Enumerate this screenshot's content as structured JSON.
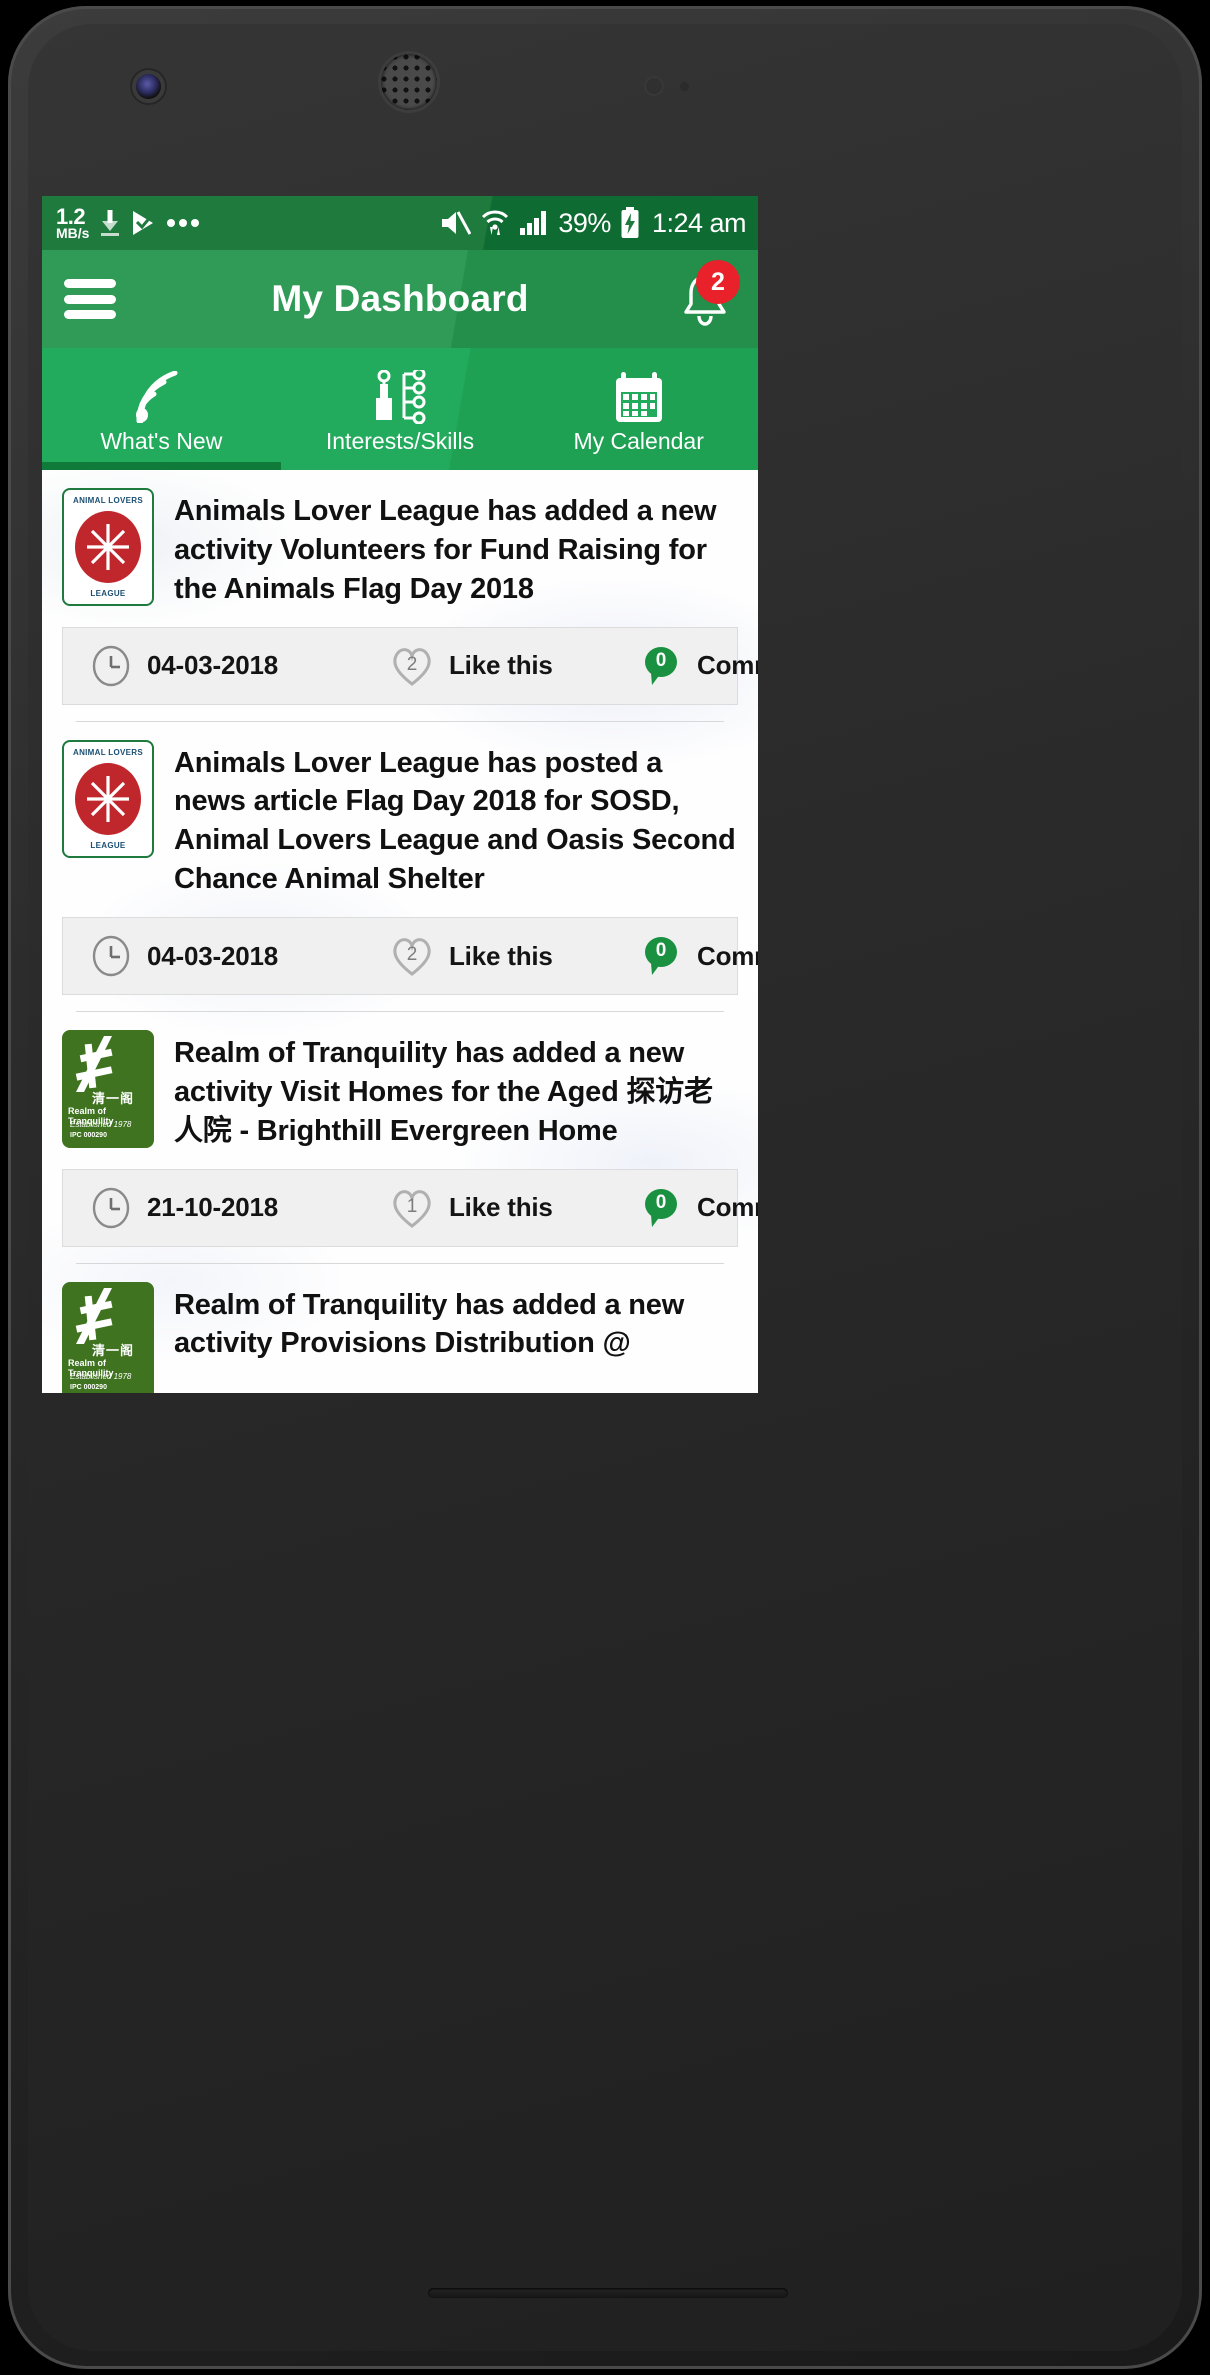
{
  "status_bar": {
    "network_speed_value": "1.2",
    "network_speed_unit": "MB/s",
    "download_icon": "download-arrow-icon",
    "app_icon": "checkmark-play-icon",
    "overflow_icon": "more-dots-icon",
    "mute_icon": "volume-mute-icon",
    "wifi_icon": "wifi-transfer-icon",
    "signal_icon": "cellular-signal-icon",
    "battery_percent": "39%",
    "battery_icon": "battery-charging-icon",
    "time": "1:24 am"
  },
  "app_bar": {
    "menu_icon": "hamburger-menu-icon",
    "title": "My Dashboard",
    "bell_icon": "notification-bell-icon",
    "notification_count": "2"
  },
  "tabs": [
    {
      "label": "What's New",
      "icon": "rss-feed-icon",
      "active": true
    },
    {
      "label": "Interests/Skills",
      "icon": "sliders-icon",
      "active": false
    },
    {
      "label": "My Calendar",
      "icon": "calendar-icon",
      "active": false
    }
  ],
  "feed": [
    {
      "logo_type": "animal-lovers-league",
      "logo_text_top": "ANIMAL LOVERS",
      "logo_text_bottom": "LEAGUE",
      "text": "Animals Lover League has added a new activity Volunteers for Fund Raising for the Animals Flag Day 2018",
      "date": "04-03-2018",
      "like_count": "2",
      "like_label": "Like this",
      "comment_count": "0",
      "comment_label": "Comments"
    },
    {
      "logo_type": "animal-lovers-league",
      "logo_text_top": "ANIMAL LOVERS",
      "logo_text_bottom": "LEAGUE",
      "text": "Animals Lover League has posted a news article Flag Day 2018 for SOSD, Animal Lovers League and Oasis Second Chance Animal Shelter",
      "date": "04-03-2018",
      "like_count": "2",
      "like_label": "Like this",
      "comment_count": "0",
      "comment_label": "Comments"
    },
    {
      "logo_type": "realm-of-tranquility",
      "logo_cn": "清一阁",
      "logo_en": "Realm of Tranquility",
      "logo_established": "Established 1978",
      "logo_ipc": "IPC 000290",
      "text": "Realm of Tranquility has added a new activity Visit Homes for the Aged 探访老人院 - Brighthill Evergreen Home",
      "date": "21-10-2018",
      "like_count": "1",
      "like_label": "Like this",
      "comment_count": "0",
      "comment_label": "Comments"
    },
    {
      "logo_type": "realm-of-tranquility",
      "logo_cn": "清一阁",
      "logo_en": "Realm of Tranquility",
      "logo_established": "Established 1978",
      "logo_ipc": "IPC 000290",
      "text": "Realm of Tranquility has added a new activity  Provisions Distribution @",
      "partial": true
    }
  ],
  "colors": {
    "status_bar_green": "#1f7a3e",
    "app_bar_green": "#2f9b56",
    "tab_bar_green": "#22ab5c",
    "tab_indicator_green": "#0f7a39",
    "badge_red": "#e8212b",
    "comment_bubble_green": "#1a9140",
    "logo_red": "#c0272d",
    "logo_green": "#3f7320"
  }
}
